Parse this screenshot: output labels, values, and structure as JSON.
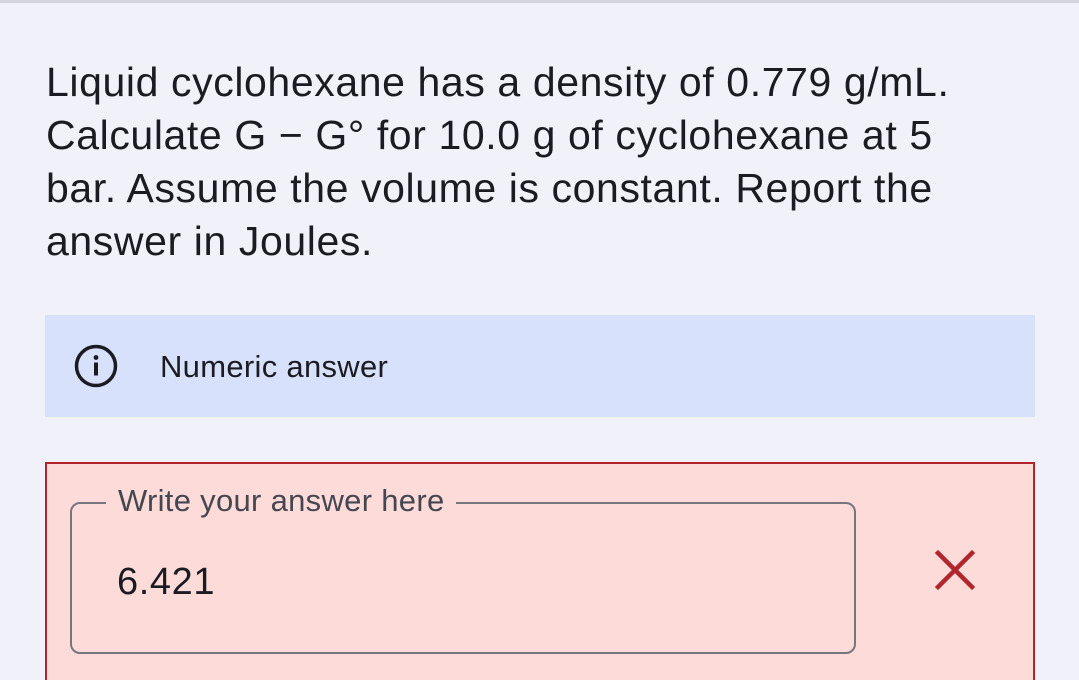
{
  "question": {
    "text": "Liquid cyclohexane has a density of 0.779 g/mL. Calculate G − G° for 10.0 g of cyclohexane at 5 bar. Assume the volume is constant. Report the answer in Joules."
  },
  "info_banner": {
    "icon": "info-icon",
    "label": "Numeric answer"
  },
  "answer": {
    "label": "Write your answer here",
    "value": "6.421",
    "status": "incorrect",
    "status_icon": "close-icon"
  },
  "colors": {
    "background": "#f1f1fa",
    "info_banner_bg": "#d7e1fb",
    "error_bg": "#fddbd9",
    "error_accent": "#b3252d",
    "outline": "#77767f"
  }
}
